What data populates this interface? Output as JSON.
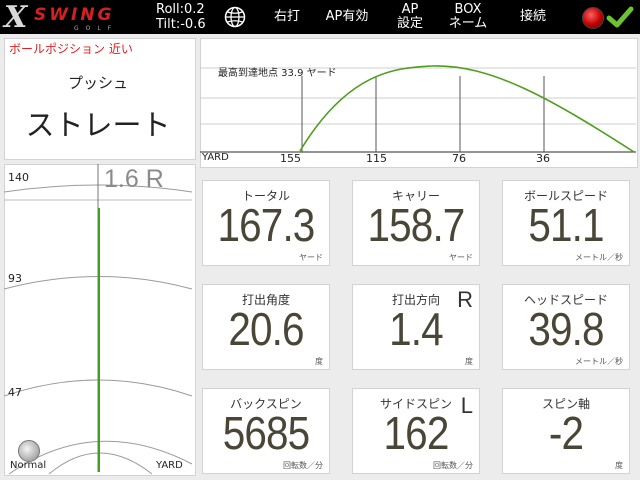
{
  "topbar": {
    "logo_x": "X",
    "logo_swing": "SWING",
    "logo_golf": "GOLF",
    "roll": "Roll:0.2",
    "tilt": "Tilt:-0.6",
    "menu": [
      {
        "label": "右打"
      },
      {
        "label": "AP有効"
      },
      {
        "label": "AP\n設定"
      },
      {
        "label": "BOX\nネーム"
      },
      {
        "label": "接続"
      }
    ],
    "globe_icon": "globe-icon",
    "status_icon": "red-record-icon",
    "confirm_icon": "green-check-icon"
  },
  "ball_position": {
    "label": "ボールポジション 近い",
    "shot_type_1": "プッシュ",
    "shot_type_2": "ストレート"
  },
  "trajectory": {
    "apex_text": "最高到達地点 33.9 ヤード",
    "xlabel": "YARD",
    "ticks": [
      "155",
      "115",
      "76",
      "36"
    ]
  },
  "lane": {
    "deviation": "1.6 R",
    "ticks": [
      "140",
      "93",
      "47"
    ],
    "mode": "Normal",
    "unit": "YARD"
  },
  "stats": [
    {
      "label": "トータル",
      "value": "167.3",
      "unit": "ヤード",
      "dir": ""
    },
    {
      "label": "キャリー",
      "value": "158.7",
      "unit": "ヤード",
      "dir": ""
    },
    {
      "label": "ボールスピード",
      "value": "51.1",
      "unit": "メートル／秒",
      "dir": ""
    },
    {
      "label": "打出角度",
      "value": "20.6",
      "unit": "度",
      "dir": ""
    },
    {
      "label": "打出方向",
      "value": "1.4",
      "unit": "度",
      "dir": "R"
    },
    {
      "label": "ヘッドスピード",
      "value": "39.8",
      "unit": "メートル／秒",
      "dir": ""
    },
    {
      "label": "バックスピン",
      "value": "5685",
      "unit": "回転数／分",
      "dir": ""
    },
    {
      "label": "サイドスピン",
      "value": "162",
      "unit": "回転数／分",
      "dir": "L"
    },
    {
      "label": "スピン軸",
      "value": "-2",
      "unit": "度",
      "dir": ""
    }
  ]
}
